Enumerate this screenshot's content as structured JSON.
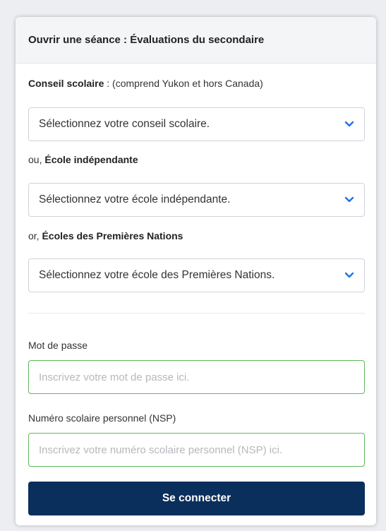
{
  "header": {
    "title": "Ouvrir une séance : Évaluations du secondaire"
  },
  "school_board": {
    "label_bold": "Conseil scolaire",
    "label_rest": " : (comprend Yukon et hors Canada)",
    "select_value": "Sélectionnez votre conseil scolaire."
  },
  "independent": {
    "label_prefix": "ou, ",
    "label_bold": "École indépendante",
    "select_value": "Sélectionnez votre école indépendante."
  },
  "first_nations": {
    "label_prefix": "or, ",
    "label_bold": "Écoles des Premières Nations",
    "select_value": "Sélectionnez votre école des Premières Nations."
  },
  "password": {
    "label": "Mot de passe",
    "placeholder": "Inscrivez votre mot de passe ici.",
    "value": ""
  },
  "pen": {
    "label": "Numéro scolaire personnel (NSP)",
    "placeholder": "Inscrivez votre numéro scolaire personnel (NSP) ici.",
    "value": ""
  },
  "submit": {
    "label": "Se connecter"
  },
  "colors": {
    "primary_button": "#0a2f5c",
    "input_border_valid": "#5cb85c",
    "chevron": "#1a73e8"
  },
  "icons": {
    "select_chevron": "chevron-down-icon"
  }
}
